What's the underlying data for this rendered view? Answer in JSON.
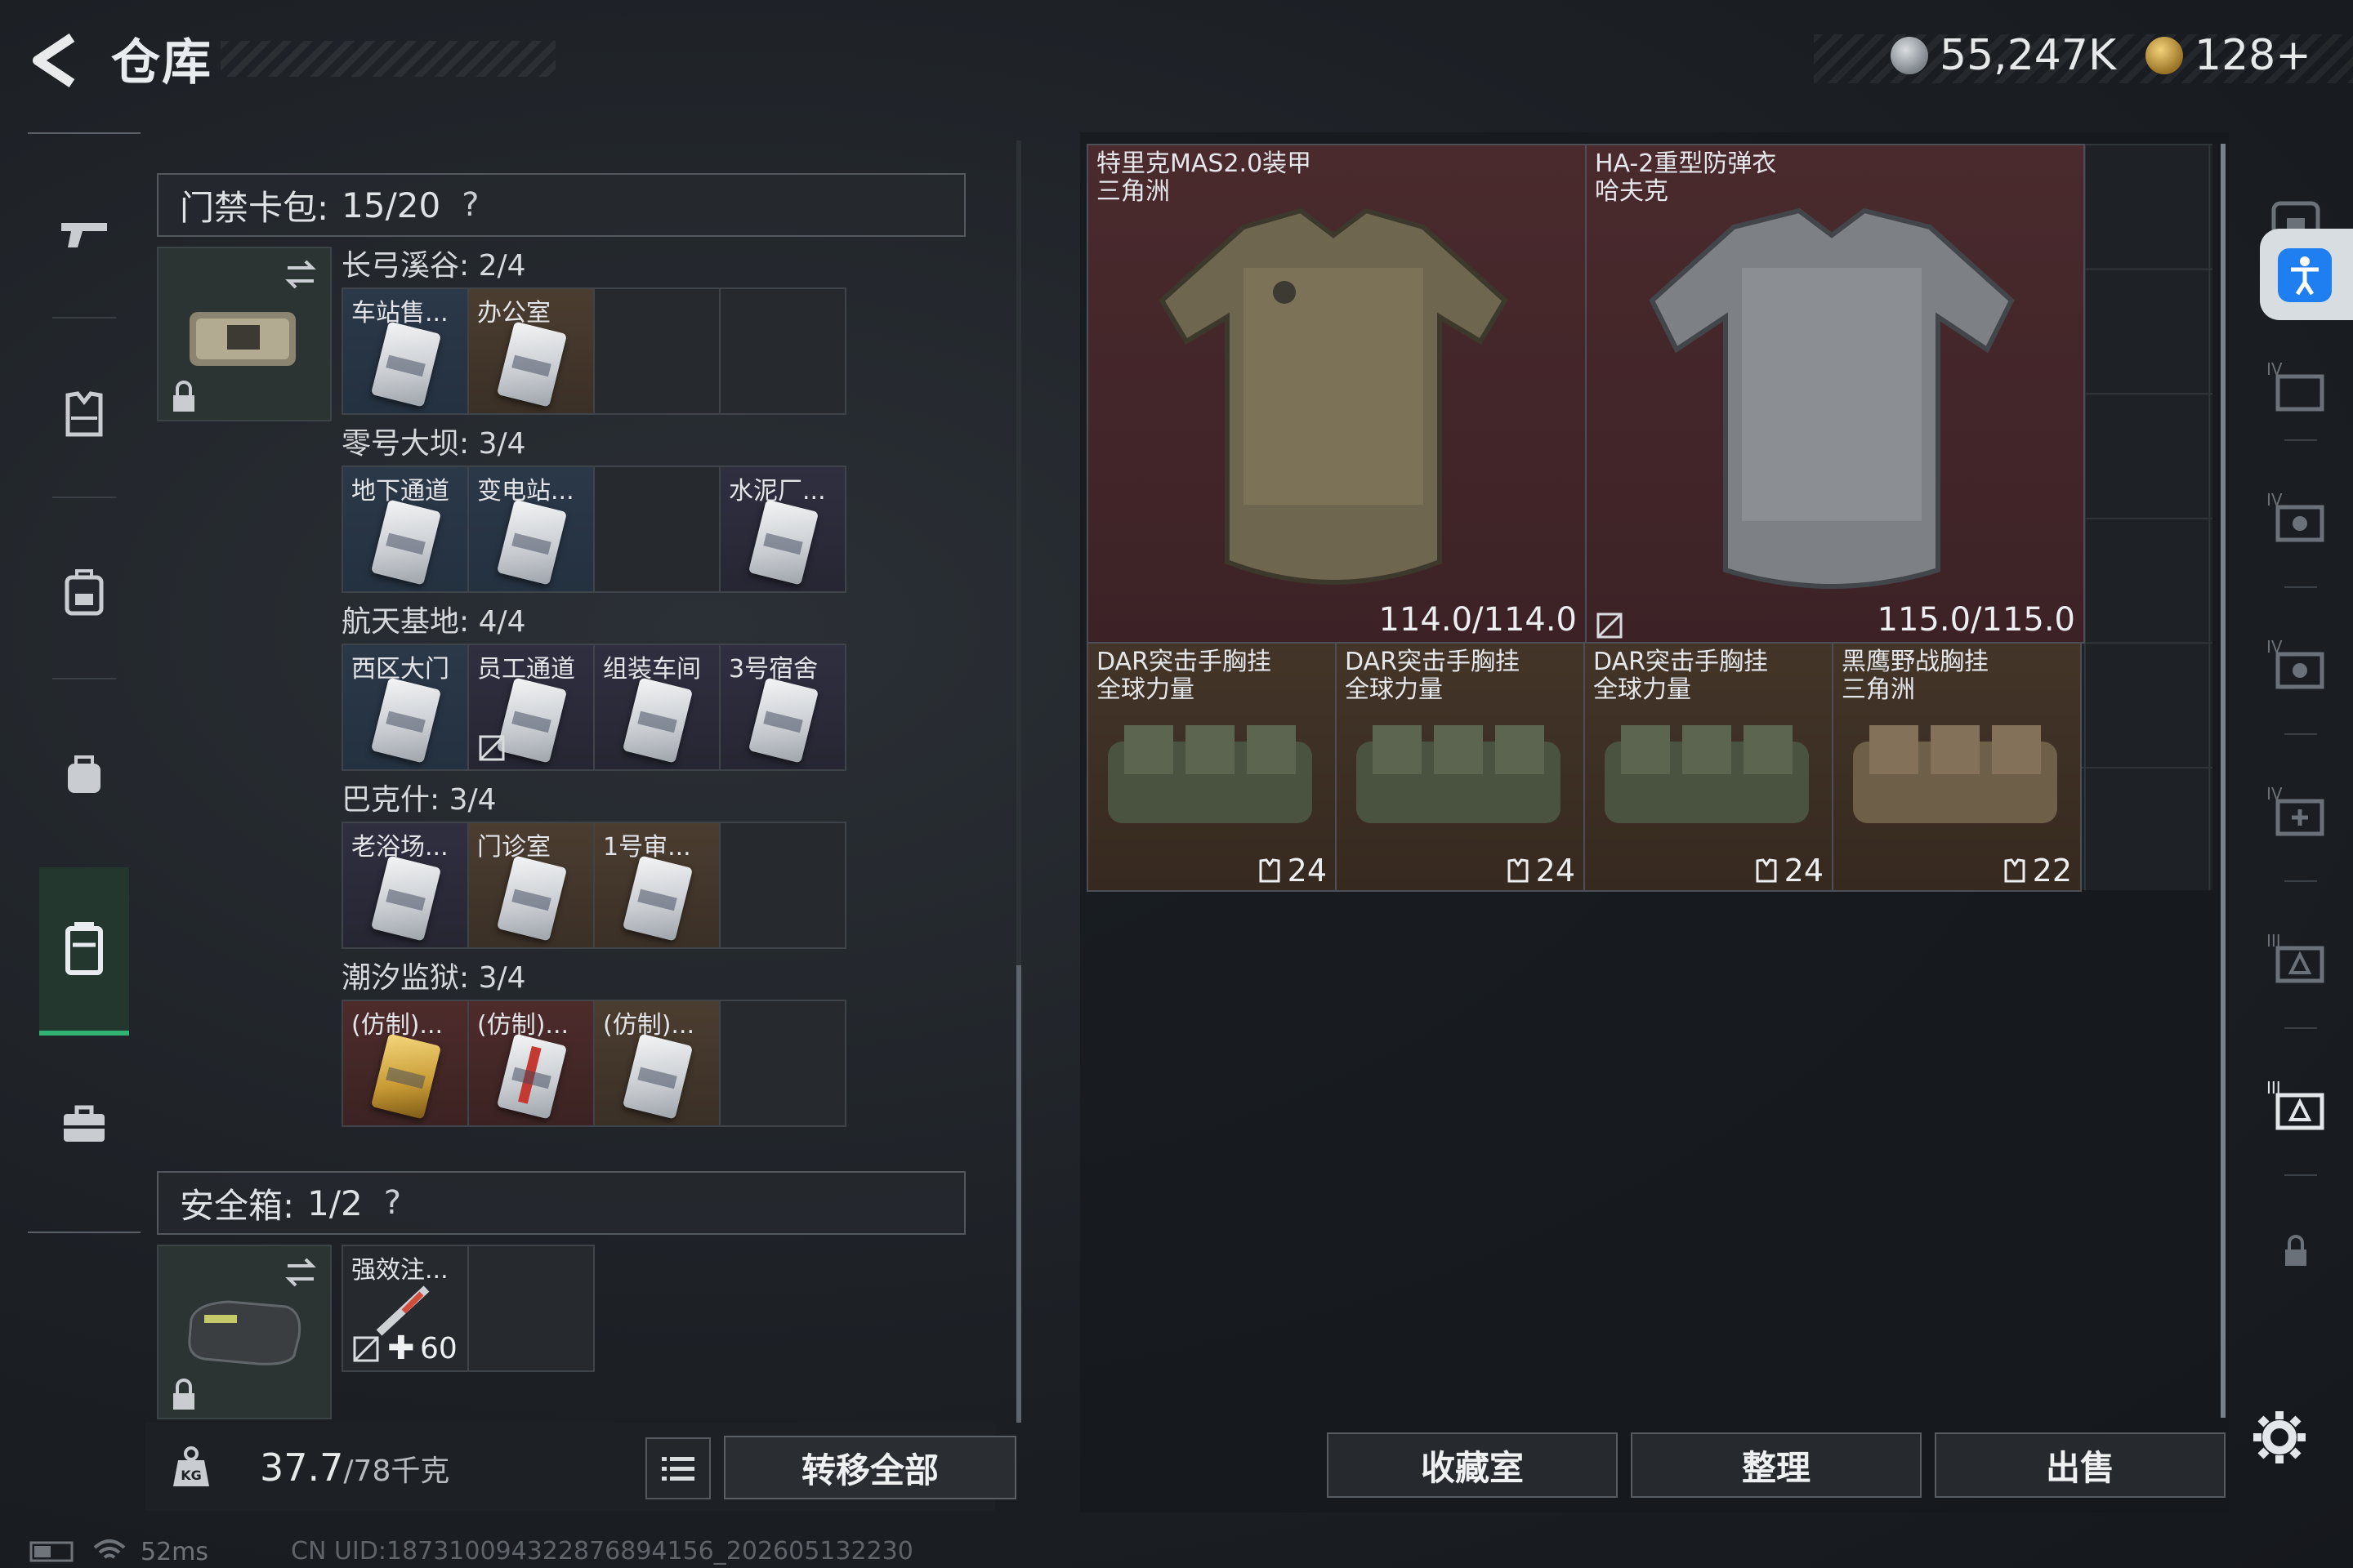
{
  "header": {
    "title": "仓库"
  },
  "currency": {
    "silver": "55,247K",
    "gold": "128+"
  },
  "keycard_pack": {
    "label": "门禁卡包:",
    "count": "15/20",
    "help": "?",
    "categories": [
      {
        "title": "长弓溪谷: 2/4",
        "slots": [
          {
            "name": "车站售...",
            "tone": "blue"
          },
          {
            "name": "办公室",
            "tone": "brown"
          },
          {
            "name": "",
            "tone": "empty"
          },
          {
            "name": "",
            "tone": "empty"
          }
        ]
      },
      {
        "title": "零号大坝: 3/4",
        "slots": [
          {
            "name": "地下通道",
            "tone": "blue"
          },
          {
            "name": "变电站...",
            "tone": "blue"
          },
          {
            "name": "",
            "tone": "empty"
          },
          {
            "name": "水泥厂...",
            "tone": "purple"
          }
        ]
      },
      {
        "title": "航天基地: 4/4",
        "slots": [
          {
            "name": "西区大门",
            "tone": "blue"
          },
          {
            "name": "员工通道",
            "tone": "purple"
          },
          {
            "name": "组装车间",
            "tone": "purple"
          },
          {
            "name": "3号宿舍",
            "tone": "purple"
          }
        ]
      },
      {
        "title": "巴克什: 3/4",
        "slots": [
          {
            "name": "老浴场...",
            "tone": "purple"
          },
          {
            "name": "门诊室",
            "tone": "brown"
          },
          {
            "name": "1号审...",
            "tone": "brown"
          },
          {
            "name": "",
            "tone": "empty"
          }
        ]
      },
      {
        "title": "潮汐监狱: 3/4",
        "slots": [
          {
            "name": "(仿制)...",
            "tone": "red"
          },
          {
            "name": "(仿制)...",
            "tone": "red"
          },
          {
            "name": "(仿制)...",
            "tone": "brown"
          },
          {
            "name": "",
            "tone": "empty"
          }
        ]
      }
    ]
  },
  "safe_box": {
    "label": "安全箱:",
    "count": "1/2",
    "help": "?",
    "item": {
      "name": "强效注...",
      "count": "60"
    }
  },
  "weight": {
    "current": "37.7",
    "max": "/78千克"
  },
  "buttons": {
    "transfer_all": "转移全部",
    "collection": "收藏室",
    "sort": "整理",
    "sell": "出售"
  },
  "stash_items": {
    "armors": [
      {
        "name": "特里克MAS2.0装甲",
        "source": "三角洲",
        "durability": "114.0/114.0"
      },
      {
        "name": "HA-2重型防弹衣",
        "source": "哈夫克",
        "durability": "115.0/115.0"
      }
    ],
    "rigs": [
      {
        "name": "DAR突击手胸挂",
        "source": "全球力量",
        "capacity": "24"
      },
      {
        "name": "DAR突击手胸挂",
        "source": "全球力量",
        "capacity": "24"
      },
      {
        "name": "DAR突击手胸挂",
        "source": "全球力量",
        "capacity": "24"
      },
      {
        "name": "黑鹰野战胸挂",
        "source": "三角洲",
        "capacity": "22"
      }
    ]
  },
  "status": {
    "ping": "52ms",
    "uid": "CN UID:18731009432287689415​6_202605132230"
  },
  "colors": {
    "accent_green": "#2fb272",
    "armor_bg": "#4a2a2d",
    "rig_bg": "#433528"
  }
}
